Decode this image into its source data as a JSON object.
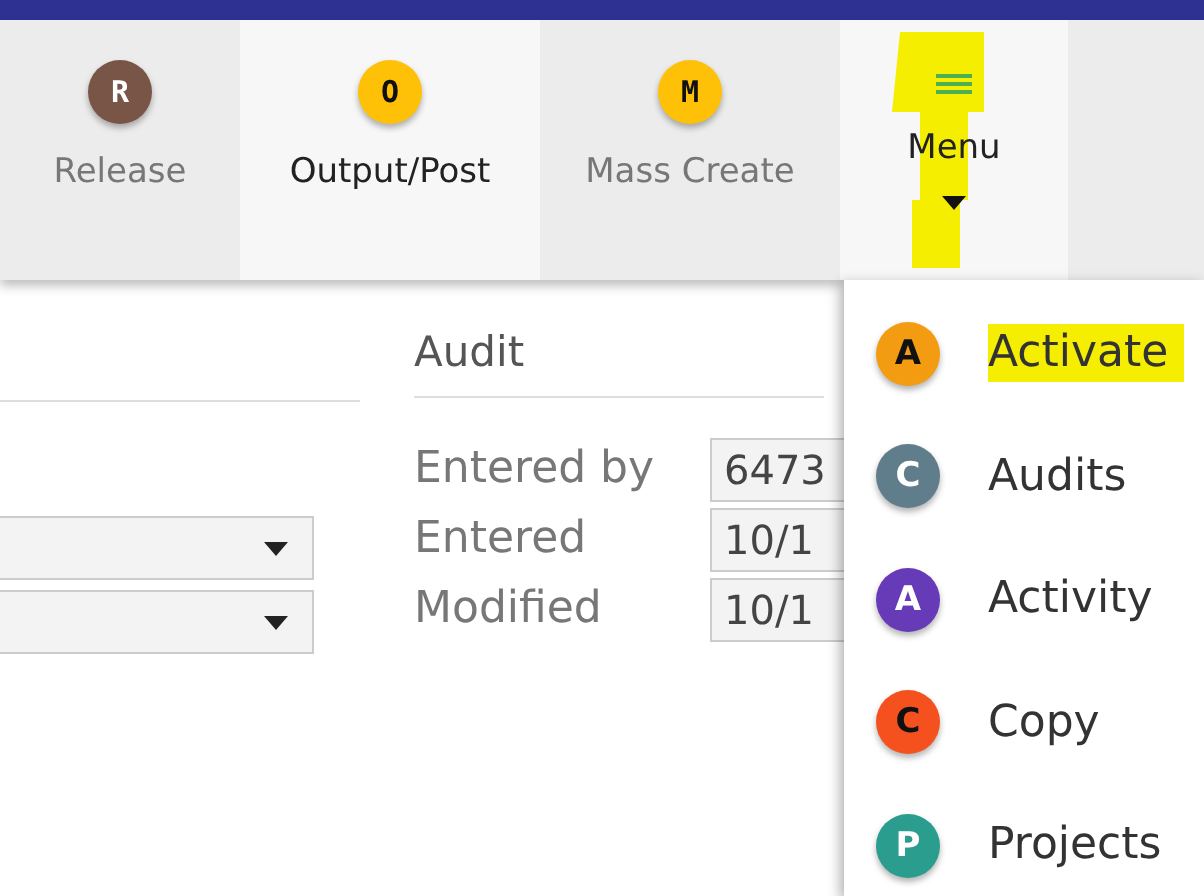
{
  "toolbar": [
    {
      "kind": "badge",
      "letter": "R",
      "label": "Release",
      "color": "#795548",
      "disabled": true
    },
    {
      "kind": "badge",
      "letter": "O",
      "label": "Output/Post",
      "color": "#ffc107",
      "disabled": false
    },
    {
      "kind": "badge",
      "letter": "M",
      "label": "Mass Create",
      "color": "#ffc107",
      "disabled": true
    },
    {
      "kind": "menu",
      "label": "Menu",
      "disabled": false,
      "highlighted": true
    }
  ],
  "form": {
    "dropdowns": [
      {
        "kind": "dropdown"
      },
      {
        "kind": "dropdown"
      }
    ]
  },
  "audit": {
    "title": "Audit",
    "fields": [
      {
        "label": "Entered by",
        "value": "6473"
      },
      {
        "label": "Entered",
        "value": "10/1"
      },
      {
        "label": "Modified",
        "value": "10/1"
      }
    ]
  },
  "menu": {
    "items": [
      {
        "letter": "A",
        "label": "Activate",
        "color": "#f39c12",
        "highlighted": true
      },
      {
        "letter": "C",
        "label": "Audits",
        "color": "#607d8b",
        "highlighted": false
      },
      {
        "letter": "A",
        "label": "Activity",
        "color": "#673ab7",
        "highlighted": false
      },
      {
        "letter": "C",
        "label": "Copy",
        "color": "#f4511e",
        "highlighted": false
      },
      {
        "letter": "P",
        "label": "Projects",
        "color": "#2a9d8f",
        "highlighted": false
      }
    ]
  }
}
